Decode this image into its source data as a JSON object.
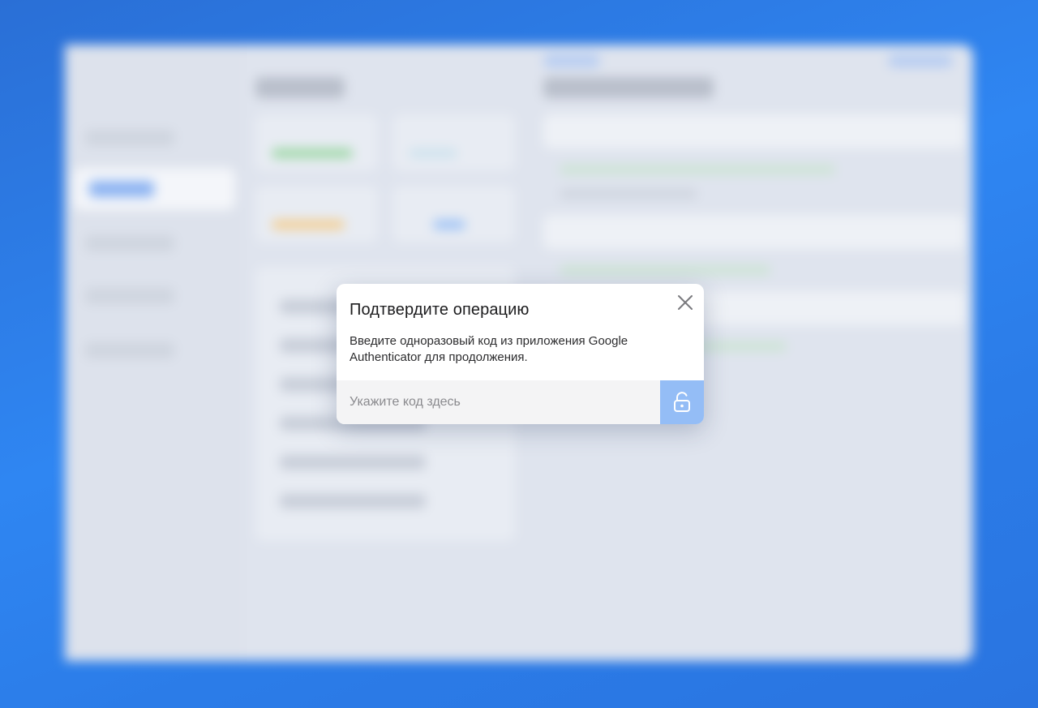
{
  "modal": {
    "title": "Подтвердите операцию",
    "description": "Введите одноразовый код из приложения Google Authenticator для продолжения.",
    "code_input_value": "",
    "code_input_placeholder": "Укажите код здесь",
    "close_icon": "close-icon",
    "submit_icon": "unlock-icon"
  },
  "colors": {
    "background": "#2f86f2",
    "submit_button": "#94bdf6",
    "input_background": "#f4f4f5"
  }
}
